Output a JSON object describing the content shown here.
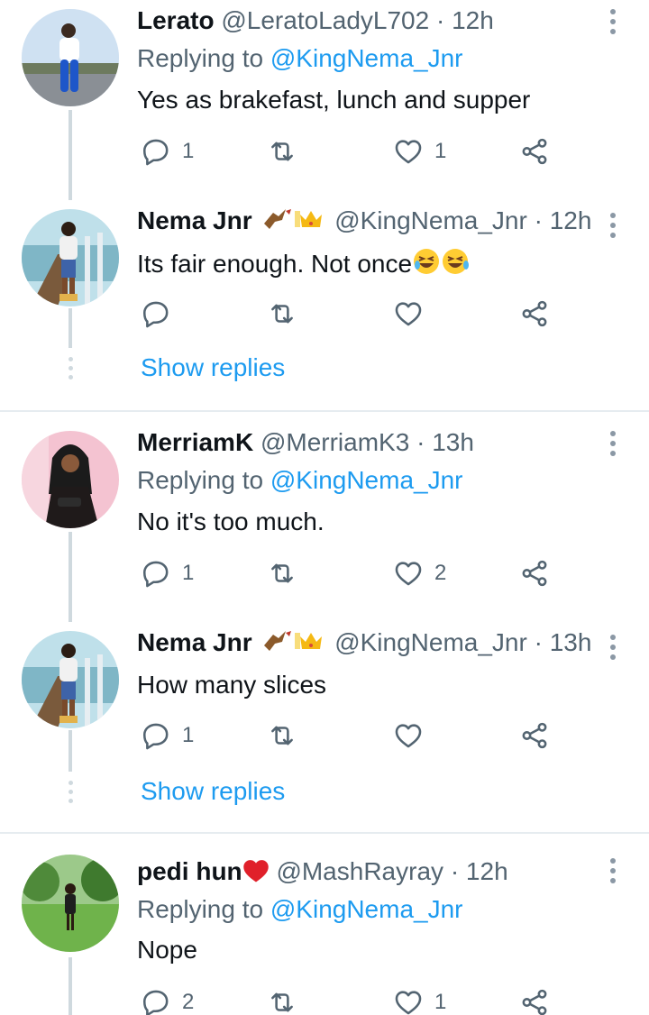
{
  "reply_prefix": "Replying to",
  "show_replies_label": "Show replies",
  "tweets": [
    {
      "name": "Lerato",
      "handle": "@LeratoLadyL702",
      "time": "12h",
      "replying_to": "@KingNema_Jnr",
      "text": "Yes as brakefast, lunch and supper",
      "replies": "1",
      "retweets": "",
      "likes": "1"
    },
    {
      "name": "Nema Jnr",
      "handle": "@KingNema_Jnr",
      "time": "12h",
      "text": "Its fair enough. Not once",
      "replies": "",
      "retweets": "",
      "likes": ""
    },
    {
      "name": "MerriamK",
      "handle": "@MerriamK3",
      "time": "13h",
      "replying_to": "@KingNema_Jnr",
      "text": "No it's too much.",
      "replies": "1",
      "retweets": "",
      "likes": "2"
    },
    {
      "name": "Nema Jnr",
      "handle": "@KingNema_Jnr",
      "time": "13h",
      "text": "How many slices",
      "replies": "1",
      "retweets": "",
      "likes": ""
    },
    {
      "name": "pedi hun",
      "handle": "@MashRayray",
      "time": "12h",
      "replying_to": "@KingNema_Jnr",
      "text": "Nope",
      "replies": "2",
      "retweets": "",
      "likes": "1"
    }
  ],
  "colors": {
    "accent": "#1d9bf0",
    "secondary_text": "#536471",
    "thread_line": "#cfd9de"
  }
}
